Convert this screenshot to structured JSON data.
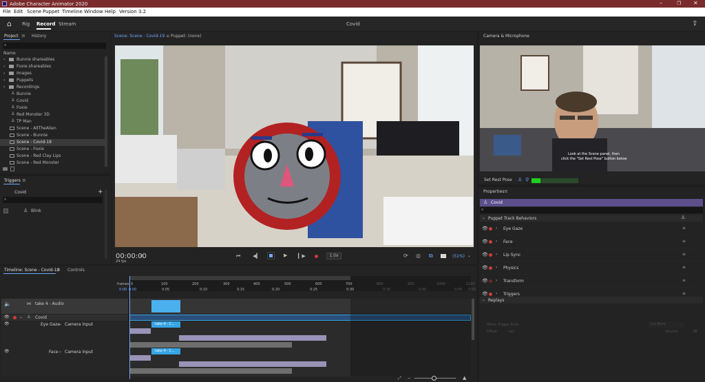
{
  "window": {
    "title": "Adobe Character Animator 2020"
  },
  "menu": [
    "File",
    "Edit",
    "Scene",
    "Puppet",
    "Timeline",
    "Window",
    "Help",
    "Version 3.2"
  ],
  "modes": {
    "rig": "Rig",
    "record": "Record",
    "stream": "Stream",
    "doc_title": "Covid"
  },
  "project": {
    "tab_project": "Project",
    "tab_history": "History",
    "col_name": "Name",
    "items": [
      "Bunnie shareables",
      "Foxie shareables",
      "Images",
      "Puppets",
      "Recordings",
      "Bunnie",
      "Covid",
      "Foxie",
      "Red Monster 3D",
      "TP Man",
      "Scene - AllTheAlien",
      "Scene - Bunnie",
      "Scene - Covid-19",
      "Scene - Foxie",
      "Scene - Red Clay Lips",
      "Scene - Red Monster"
    ]
  },
  "triggers": {
    "title": "Triggers",
    "puppet": "Covid",
    "item": "Blink"
  },
  "scene_panel": {
    "tab_scene": "Scene: Scene - Covid-19",
    "tab_puppet": "Puppet: (none)",
    "time": "00:00:00",
    "frame": "0",
    "fps": "24 fps",
    "rate": "1.0x",
    "zoom": "(51%)"
  },
  "camera": {
    "title": "Camera & Microphone",
    "hint1": "Look at the Scene panel, then",
    "hint2": "click the \"Set Rest Pose\" button below",
    "rest_btn": "Set Rest Pose"
  },
  "properties": {
    "title": "Properties",
    "puppet": "Covid",
    "section": "Puppet Track Behaviors",
    "behaviors": [
      "Eye Gaze",
      "Face",
      "Lip Sync",
      "Physics",
      "Transform",
      "Triggers"
    ],
    "replays": "Replays",
    "when": "When Trigger Ends",
    "when_val": "Cut Back",
    "offset": "Offset",
    "offset_val": "sec",
    "volume": "Volume",
    "volume_val": "dB"
  },
  "timeline": {
    "tab": "Timeline: Scene - Covid-19",
    "controls": "Controls",
    "frames_lbl": "frames",
    "ruler_frames": [
      "0",
      "100",
      "200",
      "300",
      "400",
      "500",
      "600",
      "700",
      "800",
      "900",
      "1000",
      "1100"
    ],
    "ruler_secs": [
      "0:00",
      "0:05",
      "0:10",
      "0:15",
      "0:20",
      "0:25",
      "0:30",
      "0:35",
      "0:40",
      "0:45",
      "0:50"
    ],
    "start_time": "0:00",
    "audio_track": "take 4 - Audio",
    "puppet_track": "Covid",
    "eye_row": "Eye Gaze",
    "face_row": "Face",
    "camera_input": "Camera Input",
    "take_label": "take 4 - C..."
  },
  "colors": {
    "title_bar": "#7a2b2b",
    "accent_blue": "#36a5e6",
    "purple": "#5c4f8c",
    "record_red": "#d23b3b",
    "mic_green": "#1fd11f"
  }
}
